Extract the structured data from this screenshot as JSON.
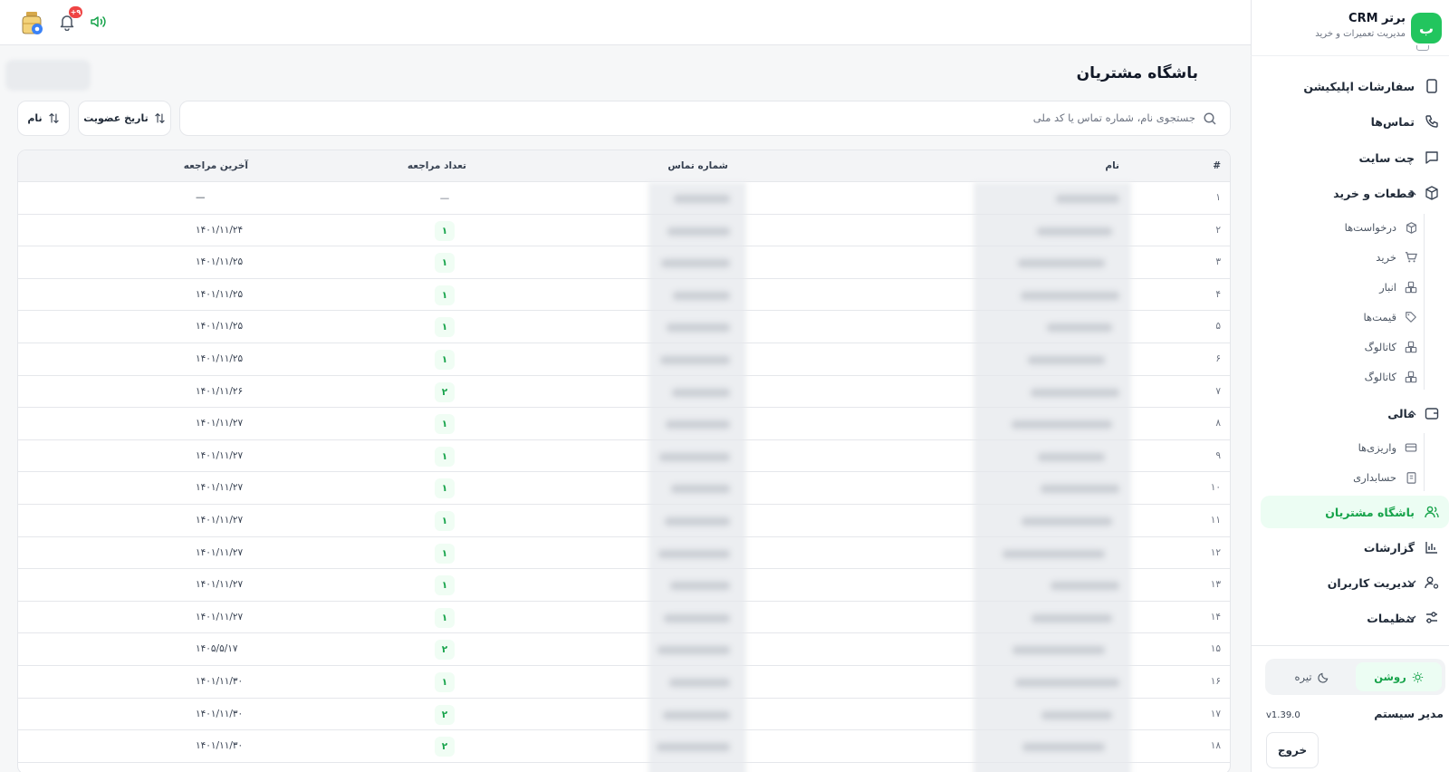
{
  "brand": {
    "logo_letter": "ب",
    "title": "برتر CRM",
    "subtitle": "مدیریت تعمیرات و خرید"
  },
  "sidebar": {
    "items": [
      {
        "label": "سفارشات اپلیکیشن",
        "icon": "phone-device-icon"
      },
      {
        "label": "تماس‌ها",
        "icon": "phone-icon"
      },
      {
        "label": "چت سایت",
        "icon": "chat-icon"
      },
      {
        "label": "قطعات و خرید",
        "icon": "box-icon",
        "expanded": true,
        "children": [
          {
            "label": "درخواست‌ها",
            "icon": "box-icon"
          },
          {
            "label": "خرید",
            "icon": "cart-icon"
          },
          {
            "label": "انبار",
            "icon": "boxes-icon"
          },
          {
            "label": "قیمت‌ها",
            "icon": "tag-icon"
          },
          {
            "label": "کاتالوگ",
            "icon": "boxes-icon"
          },
          {
            "label": "کاتالوگ",
            "icon": "boxes-icon"
          }
        ]
      },
      {
        "label": "مالی",
        "icon": "wallet-icon",
        "expanded": true,
        "children": [
          {
            "label": "واریزی‌ها",
            "icon": "card-icon"
          },
          {
            "label": "حسابداری",
            "icon": "clipboard-icon"
          }
        ]
      },
      {
        "label": "باشگاه مشتریان",
        "icon": "users-icon",
        "active": true
      },
      {
        "label": "گزارشات",
        "icon": "chart-icon"
      },
      {
        "label": "مدیریت کاربران",
        "icon": "user-cog-icon",
        "expanded": false
      },
      {
        "label": "تنظیمات",
        "icon": "sliders-icon",
        "expanded": false
      }
    ],
    "theme": {
      "light": "روشن",
      "dark": "تیره",
      "selected": "light"
    },
    "user_name": "مدیر سیستم",
    "version": "v1.39.0",
    "logout": "خروج"
  },
  "topbar": {
    "notification_count": "۹+"
  },
  "page": {
    "title": "باشگاه مشتریان",
    "search_placeholder": "جستجوی نام، شماره تماس یا کد ملی",
    "sort_date_label": "تاریخ عضویت",
    "sort_name_label": "نام"
  },
  "table": {
    "headers": {
      "index": "#",
      "name": "نام",
      "phone": "شماره تماس",
      "visits": "تعداد مراجعه",
      "last_visit": "آخرین مراجعه"
    },
    "rows": [
      {
        "index": "۱",
        "visits": "—",
        "last_visit": "—"
      },
      {
        "index": "۲",
        "visits": "۱",
        "last_visit": "۱۴۰۱/۱۱/۲۴"
      },
      {
        "index": "۳",
        "visits": "۱",
        "last_visit": "۱۴۰۱/۱۱/۲۵"
      },
      {
        "index": "۴",
        "visits": "۱",
        "last_visit": "۱۴۰۱/۱۱/۲۵"
      },
      {
        "index": "۵",
        "visits": "۱",
        "last_visit": "۱۴۰۱/۱۱/۲۵"
      },
      {
        "index": "۶",
        "visits": "۱",
        "last_visit": "۱۴۰۱/۱۱/۲۵"
      },
      {
        "index": "۷",
        "visits": "۲",
        "last_visit": "۱۴۰۱/۱۱/۲۶"
      },
      {
        "index": "۸",
        "visits": "۱",
        "last_visit": "۱۴۰۱/۱۱/۲۷"
      },
      {
        "index": "۹",
        "visits": "۱",
        "last_visit": "۱۴۰۱/۱۱/۲۷"
      },
      {
        "index": "۱۰",
        "visits": "۱",
        "last_visit": "۱۴۰۱/۱۱/۲۷"
      },
      {
        "index": "۱۱",
        "visits": "۱",
        "last_visit": "۱۴۰۱/۱۱/۲۷"
      },
      {
        "index": "۱۲",
        "visits": "۱",
        "last_visit": "۱۴۰۱/۱۱/۲۷"
      },
      {
        "index": "۱۳",
        "visits": "۱",
        "last_visit": "۱۴۰۱/۱۱/۲۷"
      },
      {
        "index": "۱۴",
        "visits": "۱",
        "last_visit": "۱۴۰۱/۱۱/۲۷"
      },
      {
        "index": "۱۵",
        "visits": "۲",
        "last_visit": "۱۴۰۵/۵/۱۷"
      },
      {
        "index": "۱۶",
        "visits": "۱",
        "last_visit": "۱۴۰۱/۱۱/۳۰"
      },
      {
        "index": "۱۷",
        "visits": "۲",
        "last_visit": "۱۴۰۱/۱۱/۳۰"
      },
      {
        "index": "۱۸",
        "visits": "۲",
        "last_visit": "۱۴۰۱/۱۱/۳۰"
      }
    ]
  },
  "colors": {
    "accent": "#22c55e",
    "accent_text": "#16a34a",
    "active_bg": "#ecfdf3",
    "badge": "#ef4444"
  }
}
